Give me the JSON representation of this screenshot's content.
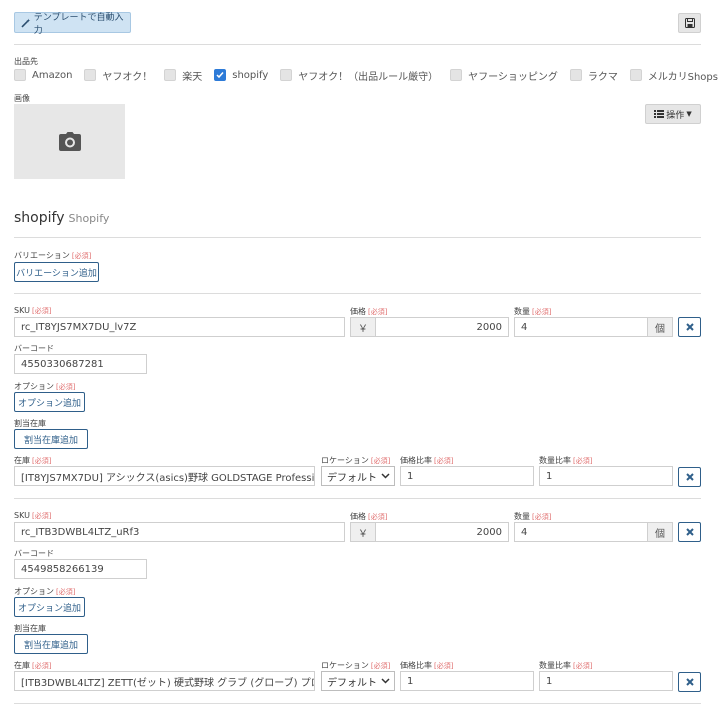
{
  "toolbar": {
    "auto_fill_label": "テンプレートで自動入力"
  },
  "channels": {
    "label": "出品先",
    "items": [
      {
        "label": "Amazon",
        "checked": false
      },
      {
        "label": "ヤフオク！",
        "checked": false
      },
      {
        "label": "楽天",
        "checked": false
      },
      {
        "label": "shopify",
        "checked": true
      },
      {
        "label": "ヤフオク！（出品ルール厳守）",
        "checked": false
      },
      {
        "label": "ヤフーショッピング",
        "checked": false
      },
      {
        "label": "ラクマ",
        "checked": false
      },
      {
        "label": "メルカリShops",
        "checked": false
      }
    ]
  },
  "image": {
    "label": "画像",
    "ops_label": "操作"
  },
  "section": {
    "title": "shopify",
    "subtitle": "Shopify"
  },
  "variation": {
    "label": "バリエーション",
    "required": "[必須]",
    "add_label": "バリエーション追加"
  },
  "labels": {
    "sku": "SKU",
    "price": "価格",
    "qty": "数量",
    "barcode": "バーコード",
    "option": "オプション",
    "alloc": "割当在庫",
    "stock": "在庫",
    "location": "ロケーション",
    "price_ratio": "価格比率",
    "qty_ratio": "数量比率",
    "required": "[必須]",
    "option_add": "オプション追加",
    "alloc_add": "割当在庫追加",
    "yen": "￥",
    "unit": "個"
  },
  "variants": [
    {
      "sku": "rc_IT8YJS7MX7DU_lv7Z",
      "price": "2000",
      "qty": "4",
      "barcode": "4550330687281",
      "stock": "[IT8YJS7MX7DU] アシックス(asics)野球 GOLDSTAGE Professic",
      "location": "デフォルト",
      "price_ratio": "1",
      "qty_ratio": "1"
    },
    {
      "sku": "rc_ITB3DWBL4LTZ_uRf3",
      "price": "2000",
      "qty": "4",
      "barcode": "4549858266139",
      "stock": "[ITB3DWBL4LTZ] ZETT(ゼット) 硬式野球 グラブ (グローブ) プロステ",
      "location": "デフォルト",
      "price_ratio": "1",
      "qty_ratio": "1"
    }
  ]
}
